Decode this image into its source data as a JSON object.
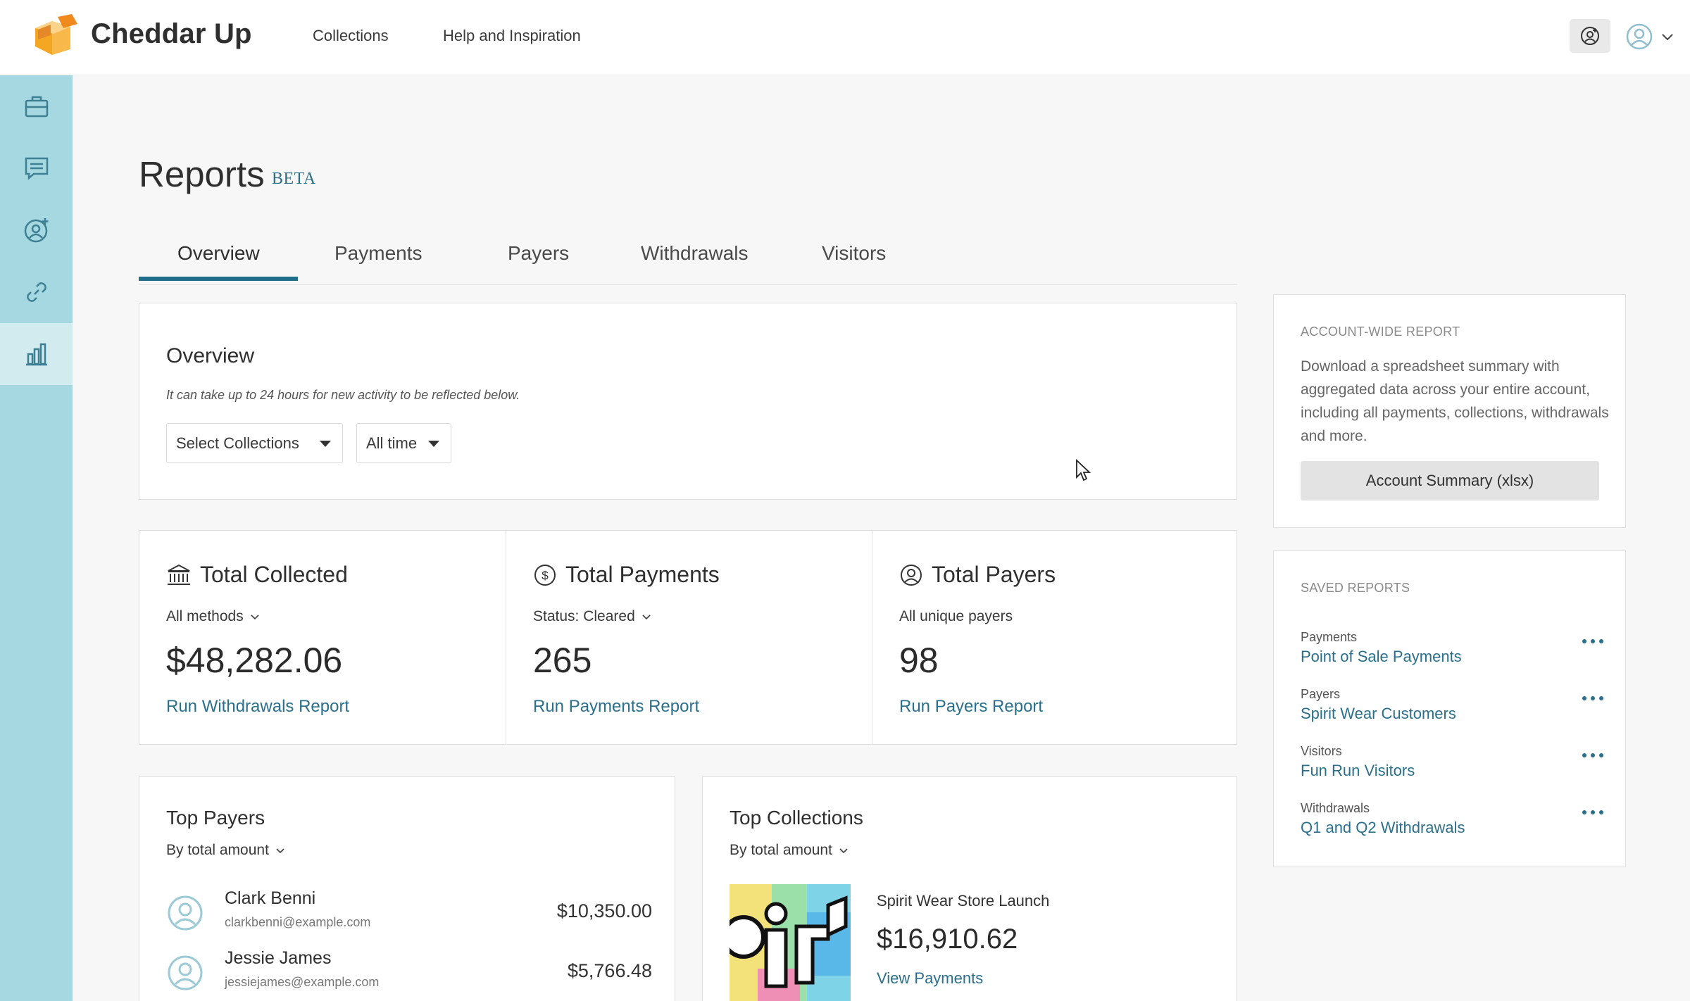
{
  "app": {
    "brand": "Cheddar Up"
  },
  "topnav": {
    "collections": "Collections",
    "help": "Help and Inspiration"
  },
  "page": {
    "title": "Reports",
    "badge": "BETA"
  },
  "tabs": [
    {
      "label": "Overview"
    },
    {
      "label": "Payments"
    },
    {
      "label": "Payers"
    },
    {
      "label": "Withdrawals"
    },
    {
      "label": "Visitors"
    }
  ],
  "overview": {
    "title": "Overview",
    "note": "It can take up to 24 hours for new activity to be reflected below.",
    "select_collections": "Select Collections",
    "select_time": "All time"
  },
  "stats": [
    {
      "title": "Total Collected",
      "filter": "All methods",
      "value": "$48,282.06",
      "link": "Run Withdrawals Report"
    },
    {
      "title": "Total Payments",
      "filter": "Status: Cleared",
      "value": "265",
      "link": "Run Payments Report"
    },
    {
      "title": "Total Payers",
      "filter": "All unique payers",
      "value": "98",
      "link": "Run Payers Report"
    }
  ],
  "top_payers": {
    "title": "Top Payers",
    "sort": "By total amount",
    "items": [
      {
        "name": "Clark Benni",
        "email": "clarkbenni@example.com",
        "amount": "$10,350.00"
      },
      {
        "name": "Jessie James",
        "email": "jessiejames@example.com",
        "amount": "$5,766.48"
      }
    ]
  },
  "top_collections": {
    "title": "Top Collections",
    "sort": "By total amount",
    "item": {
      "name": "Spirit Wear Store Launch",
      "amount": "$16,910.62",
      "link": "View Payments"
    }
  },
  "account_report": {
    "label": "ACCOUNT-WIDE REPORT",
    "description": "Download a spreadsheet summary with aggregated data across your entire account, including all payments, collections, withdrawals and more.",
    "button": "Account Summary (xlsx)"
  },
  "saved_reports": {
    "label": "SAVED REPORTS",
    "items": [
      {
        "type": "Payments",
        "name": "Point of Sale Payments"
      },
      {
        "type": "Payers",
        "name": "Spirit Wear Customers"
      },
      {
        "type": "Visitors",
        "name": "Fun Run Visitors"
      },
      {
        "type": "Withdrawals",
        "name": "Q1 and Q2 Withdrawals"
      }
    ]
  },
  "colors": {
    "accent": "#1f6e8c",
    "link": "#2a6f8c",
    "sidebar": "#a6d8e1",
    "logo": "#f5a623"
  }
}
